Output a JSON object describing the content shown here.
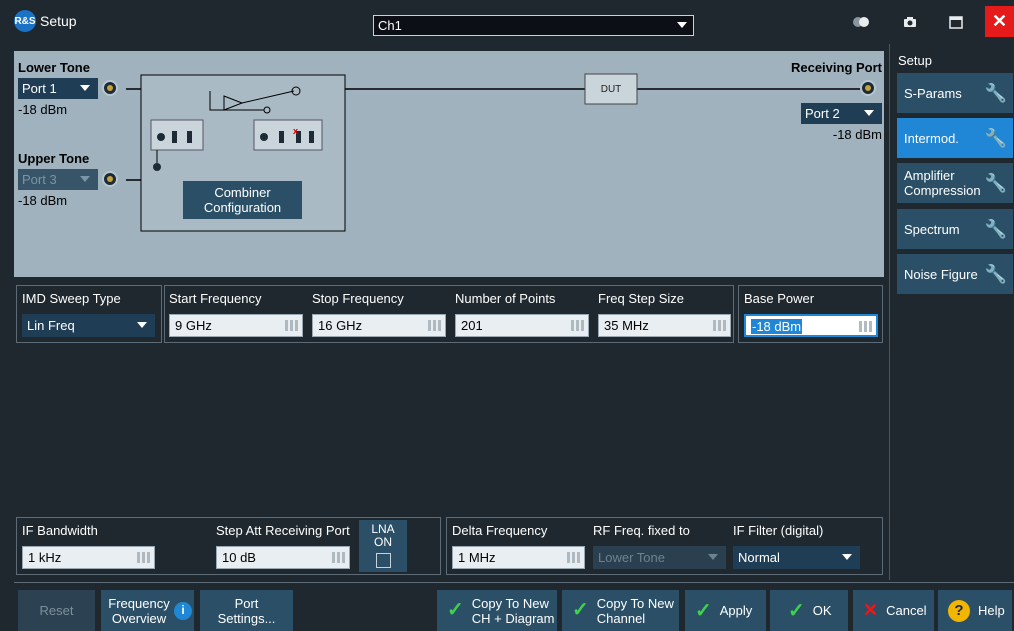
{
  "window": {
    "title": "Setup",
    "logo_text": "R&S",
    "channel": "Ch1",
    "close_symbol": "✕"
  },
  "diagram": {
    "lower_tone_label": "Lower Tone",
    "lower_tone_port": "Port 1",
    "lower_tone_power": "-18 dBm",
    "upper_tone_label": "Upper Tone",
    "upper_tone_port": "Port 3",
    "upper_tone_power": "-18 dBm",
    "receiving_label": "Receiving Port",
    "receiving_port": "Port 2",
    "receiving_power": "-18 dBm",
    "dut_label": "DUT",
    "combiner_button": "Combiner Configuration"
  },
  "sidebar": {
    "title": "Setup",
    "items": [
      {
        "label": "S-Params",
        "active": false
      },
      {
        "label": "Intermod.",
        "active": true
      },
      {
        "label": "Amplifier Compression",
        "active": false
      },
      {
        "label": "Spectrum",
        "active": false
      },
      {
        "label": "Noise Figure",
        "active": false
      }
    ]
  },
  "sweep": {
    "imd_sweep_type_label": "IMD Sweep Type",
    "imd_sweep_type_value": "Lin Freq",
    "start_freq_label": "Start Frequency",
    "start_freq_value": "9 GHz",
    "stop_freq_label": "Stop Frequency",
    "stop_freq_value": "16 GHz",
    "num_points_label": "Number of Points",
    "num_points_value": "201",
    "step_size_label": "Freq Step Size",
    "step_size_value": "35 MHz",
    "base_power_label": "Base Power",
    "base_power_value": "-18 dBm"
  },
  "receiver": {
    "if_bw_label": "IF Bandwidth",
    "if_bw_value": "1 kHz",
    "step_att_label": "Step Att Receiving Port",
    "step_att_value": "10 dB",
    "lna_label": "LNA ON",
    "delta_freq_label": "Delta Frequency",
    "delta_freq_value": "1 MHz",
    "rf_fixed_label": "RF Freq. fixed to",
    "rf_fixed_value": "Lower Tone",
    "if_filter_label": "IF Filter (digital)",
    "if_filter_value": "Normal"
  },
  "footer": {
    "reset": "Reset",
    "freq_overview": "Frequency Overview",
    "port_settings": "Port Settings...",
    "copy_ch_diagram": "Copy To New CH + Diagram",
    "copy_channel": "Copy To New Channel",
    "apply": "Apply",
    "ok": "OK",
    "cancel": "Cancel",
    "help": "Help"
  },
  "colors": {
    "accent": "#1f87d6",
    "panel_bg": "#1f282f",
    "diagram_bg": "#9fb2be",
    "button_bg": "#2a4f66",
    "ok_green": "#3fd24b",
    "close_red": "#e51a1a"
  },
  "icons": [
    "app-logo-icon",
    "toggle-icon",
    "camera-icon",
    "maximize-icon",
    "close-icon",
    "wrench-icon",
    "info-icon",
    "checkmark-icon",
    "cancel-x-icon",
    "help-icon"
  ]
}
